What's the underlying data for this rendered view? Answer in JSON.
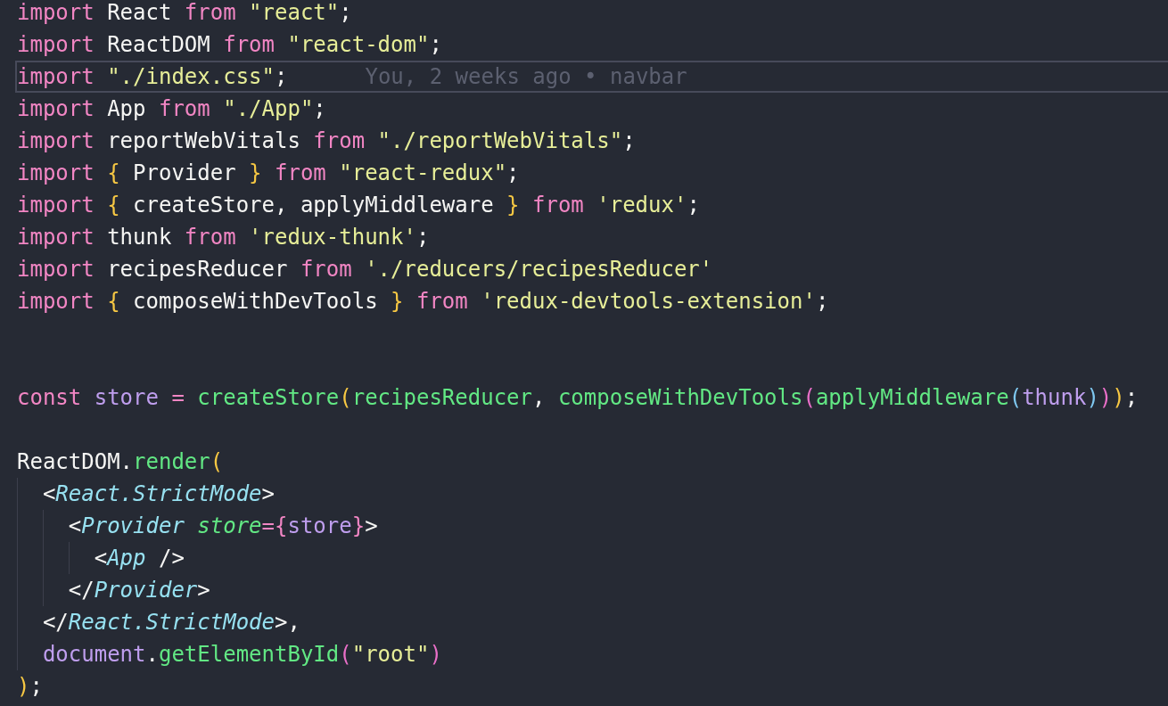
{
  "editor": {
    "lines": [
      {
        "kind": "code",
        "tokens": [
          {
            "text": "import",
            "kind": "keyword"
          },
          {
            "text": " React ",
            "kind": "plain"
          },
          {
            "text": "from ",
            "kind": "keyword"
          },
          {
            "text": "\"react\"",
            "kind": "string"
          },
          {
            "text": ";",
            "kind": "plain"
          }
        ]
      },
      {
        "kind": "code",
        "tokens": [
          {
            "text": "import",
            "kind": "keyword"
          },
          {
            "text": " ReactDOM ",
            "kind": "plain"
          },
          {
            "text": "from ",
            "kind": "keyword"
          },
          {
            "text": "\"react-dom\"",
            "kind": "string"
          },
          {
            "text": ";",
            "kind": "plain"
          }
        ]
      },
      {
        "kind": "code",
        "current": true,
        "blame": "You, 2 weeks ago • navbar",
        "tokens": [
          {
            "text": "import ",
            "kind": "keyword"
          },
          {
            "text": "\"./index.css\"",
            "kind": "string"
          },
          {
            "text": ";",
            "kind": "plain"
          }
        ]
      },
      {
        "kind": "code",
        "tokens": [
          {
            "text": "import",
            "kind": "keyword"
          },
          {
            "text": " App ",
            "kind": "plain"
          },
          {
            "text": "from ",
            "kind": "keyword"
          },
          {
            "text": "\"./App\"",
            "kind": "string"
          },
          {
            "text": ";",
            "kind": "plain"
          }
        ]
      },
      {
        "kind": "code",
        "tokens": [
          {
            "text": "import",
            "kind": "keyword"
          },
          {
            "text": " reportWebVitals ",
            "kind": "plain"
          },
          {
            "text": "from ",
            "kind": "keyword"
          },
          {
            "text": "\"./reportWebVitals\"",
            "kind": "string"
          },
          {
            "text": ";",
            "kind": "plain"
          }
        ]
      },
      {
        "kind": "code",
        "tokens": [
          {
            "text": "import ",
            "kind": "keyword"
          },
          {
            "text": "{",
            "kind": "bracket1"
          },
          {
            "text": " Provider ",
            "kind": "plain"
          },
          {
            "text": "} ",
            "kind": "bracket1"
          },
          {
            "text": "from ",
            "kind": "keyword"
          },
          {
            "text": "\"react-redux\"",
            "kind": "string"
          },
          {
            "text": ";",
            "kind": "plain"
          }
        ]
      },
      {
        "kind": "code",
        "tokens": [
          {
            "text": "import ",
            "kind": "keyword"
          },
          {
            "text": "{",
            "kind": "bracket1"
          },
          {
            "text": " createStore, applyMiddleware ",
            "kind": "plain"
          },
          {
            "text": "} ",
            "kind": "bracket1"
          },
          {
            "text": "from ",
            "kind": "keyword"
          },
          {
            "text": "'redux'",
            "kind": "string"
          },
          {
            "text": ";",
            "kind": "plain"
          }
        ]
      },
      {
        "kind": "code",
        "tokens": [
          {
            "text": "import",
            "kind": "keyword"
          },
          {
            "text": " thunk ",
            "kind": "plain"
          },
          {
            "text": "from ",
            "kind": "keyword"
          },
          {
            "text": "'redux-thunk'",
            "kind": "string"
          },
          {
            "text": ";",
            "kind": "plain"
          }
        ]
      },
      {
        "kind": "code",
        "tokens": [
          {
            "text": "import",
            "kind": "keyword"
          },
          {
            "text": " recipesReducer ",
            "kind": "plain"
          },
          {
            "text": "from ",
            "kind": "keyword"
          },
          {
            "text": "'./reducers/recipesReducer'",
            "kind": "string"
          }
        ]
      },
      {
        "kind": "code",
        "tokens": [
          {
            "text": "import ",
            "kind": "keyword"
          },
          {
            "text": "{",
            "kind": "bracket1"
          },
          {
            "text": " composeWithDevTools ",
            "kind": "plain"
          },
          {
            "text": "} ",
            "kind": "bracket1"
          },
          {
            "text": "from ",
            "kind": "keyword"
          },
          {
            "text": "'redux-devtools-extension'",
            "kind": "string"
          },
          {
            "text": ";",
            "kind": "plain"
          }
        ]
      },
      {
        "kind": "blank"
      },
      {
        "kind": "blank"
      },
      {
        "kind": "code",
        "tokens": [
          {
            "text": "const ",
            "kind": "keyword"
          },
          {
            "text": "store ",
            "kind": "variable"
          },
          {
            "text": "= ",
            "kind": "keyword"
          },
          {
            "text": "createStore",
            "kind": "function"
          },
          {
            "text": "(",
            "kind": "bracket1"
          },
          {
            "text": "recipesReducer",
            "kind": "function"
          },
          {
            "text": ", ",
            "kind": "plain"
          },
          {
            "text": "composeWithDevTools",
            "kind": "function"
          },
          {
            "text": "(",
            "kind": "bracket2"
          },
          {
            "text": "applyMiddleware",
            "kind": "function"
          },
          {
            "text": "(",
            "kind": "bracket3"
          },
          {
            "text": "thunk",
            "kind": "variable"
          },
          {
            "text": ")",
            "kind": "bracket3"
          },
          {
            "text": ")",
            "kind": "bracket2"
          },
          {
            "text": ")",
            "kind": "bracket1"
          },
          {
            "text": ";",
            "kind": "plain"
          }
        ]
      },
      {
        "kind": "blank"
      },
      {
        "kind": "code",
        "tokens": [
          {
            "text": "ReactDOM.",
            "kind": "plain"
          },
          {
            "text": "render",
            "kind": "function"
          },
          {
            "text": "(",
            "kind": "bracket1"
          }
        ]
      },
      {
        "kind": "code",
        "tokens": [
          {
            "text": "  <",
            "kind": "plain"
          },
          {
            "text": "React.StrictMode",
            "kind": "tag"
          },
          {
            "text": ">",
            "kind": "plain"
          }
        ]
      },
      {
        "kind": "code",
        "tokens": [
          {
            "text": "    <",
            "kind": "plain"
          },
          {
            "text": "Provider ",
            "kind": "tag"
          },
          {
            "text": "store",
            "kind": "attribute"
          },
          {
            "text": "=",
            "kind": "keyword"
          },
          {
            "text": "{",
            "kind": "keyword"
          },
          {
            "text": "store",
            "kind": "variable"
          },
          {
            "text": "}",
            "kind": "keyword"
          },
          {
            "text": ">",
            "kind": "plain"
          }
        ]
      },
      {
        "kind": "code",
        "tokens": [
          {
            "text": "      <",
            "kind": "plain"
          },
          {
            "text": "App",
            "kind": "tag"
          },
          {
            "text": " />",
            "kind": "plain"
          }
        ]
      },
      {
        "kind": "code",
        "tokens": [
          {
            "text": "    </",
            "kind": "plain"
          },
          {
            "text": "Provider",
            "kind": "tag"
          },
          {
            "text": ">",
            "kind": "plain"
          }
        ]
      },
      {
        "kind": "code",
        "tokens": [
          {
            "text": "  </",
            "kind": "plain"
          },
          {
            "text": "React.StrictMode",
            "kind": "tag"
          },
          {
            "text": ">,",
            "kind": "plain"
          }
        ]
      },
      {
        "kind": "code",
        "tokens": [
          {
            "text": "  document",
            "kind": "variable"
          },
          {
            "text": ".",
            "kind": "plain"
          },
          {
            "text": "getElementById",
            "kind": "function"
          },
          {
            "text": "(",
            "kind": "bracket2"
          },
          {
            "text": "\"root\"",
            "kind": "string"
          },
          {
            "text": ")",
            "kind": "bracket2"
          }
        ]
      },
      {
        "kind": "code",
        "tokens": [
          {
            "text": ")",
            "kind": "bracket1"
          },
          {
            "text": ";",
            "kind": "plain"
          }
        ]
      }
    ]
  }
}
